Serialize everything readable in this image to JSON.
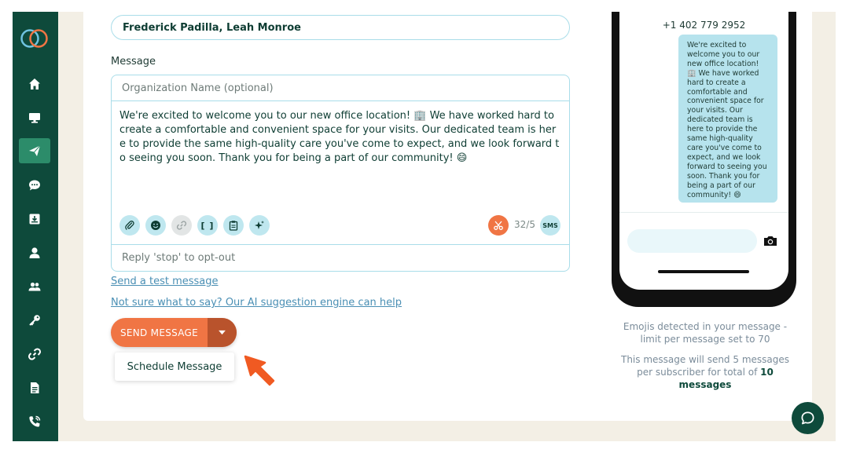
{
  "recipients": {
    "value": "Frederick Padilla, Leah Monroe"
  },
  "message_label": "Message",
  "organization": {
    "placeholder": "Organization Name (optional)"
  },
  "message": {
    "body": "We're excited to welcome you to our new office location! 🏢 We have worked hard to create a comfortable and convenient space for your visits. Our dedicated team is here to provide the same high-quality care you've come to expect, and we look forward to seeing you soon. Thank you for being a part of our community! 😄"
  },
  "toolbar": {
    "icons": [
      "paperclip-icon",
      "emoji-icon",
      "link-icon",
      "brackets-icon",
      "clipboard-icon",
      "sparkle-icon"
    ],
    "brackets_label": "[ ]",
    "counter": "32/5",
    "channel": "SMS"
  },
  "optout_text": "Reply 'stop' to opt-out",
  "links": {
    "test_message": "Send a test message",
    "ai_suggestion": "Not sure what to say? Our AI suggestion engine can help"
  },
  "send_button": {
    "label": "SEND MESSAGE"
  },
  "dropdown": {
    "schedule": "Schedule Message"
  },
  "preview": {
    "phone_number": "+1 402 779 2952",
    "bubble_text": "We're excited to welcome you to our new office location! 🏢 We have worked hard to create a comfortable and convenient space for your visits. Our dedicated team is here to provide the same high-quality care you've come to expect, and we look forward to seeing you soon. Thank you for being a part of our community! 😄"
  },
  "info": {
    "emoji_notice": "Emojis detected in your message - limit per message set to 70",
    "count_notice_prefix": "This message will send 5 messages per subscriber for total of",
    "count_notice_total": "10 messages"
  },
  "colors": {
    "sidebar": "#0e4a3b",
    "active_nav": "#2c8c6a",
    "accent_orange": "#f07544",
    "field_border": "#a9dde9",
    "bubble": "#b6e3ed"
  }
}
